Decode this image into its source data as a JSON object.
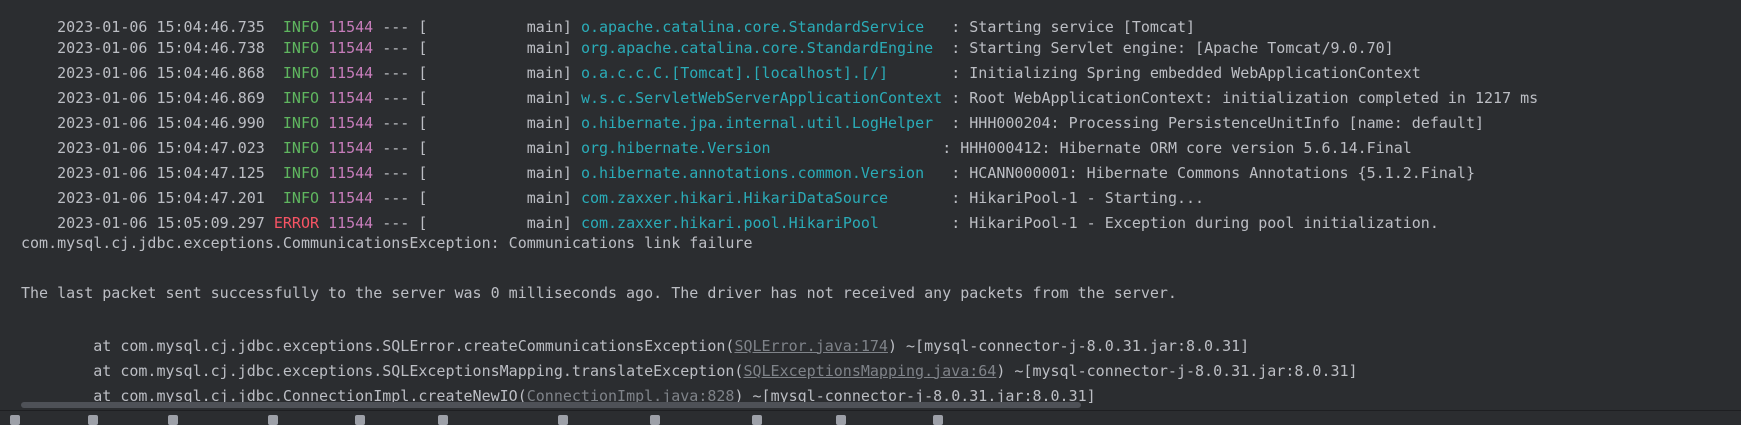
{
  "log_lines": [
    {
      "date": "2023-01-06 15:04:46.738",
      "level": "INFO",
      "pid": "11544",
      "sep": "---",
      "thread_open": "[",
      "thread": "main]",
      "logger": "org.apache.catalina.core.StandardEngine",
      "message": ": Starting Servlet engine: [Apache Tomcat/9.0.70]"
    },
    {
      "date": "2023-01-06 15:04:46.868",
      "level": "INFO",
      "pid": "11544",
      "sep": "---",
      "thread_open": "[",
      "thread": "main]",
      "logger": "o.a.c.c.C.[Tomcat].[localhost].[/]",
      "message": ": Initializing Spring embedded WebApplicationContext"
    },
    {
      "date": "2023-01-06 15:04:46.869",
      "level": "INFO",
      "pid": "11544",
      "sep": "---",
      "thread_open": "[",
      "thread": "main]",
      "logger": "w.s.c.ServletWebServerApplicationContext",
      "message": ": Root WebApplicationContext: initialization completed in 1217 ms"
    },
    {
      "date": "2023-01-06 15:04:46.990",
      "level": "INFO",
      "pid": "11544",
      "sep": "---",
      "thread_open": "[",
      "thread": "main]",
      "logger": "o.hibernate.jpa.internal.util.LogHelper",
      "message": ": HHH000204: Processing PersistenceUnitInfo [name: default]"
    },
    {
      "date": "2023-01-06 15:04:47.023",
      "level": "INFO",
      "pid": "11544",
      "sep": "---",
      "thread_open": "[",
      "thread": "main]",
      "logger": "org.hibernate.Version",
      "message": ": HHH000412: Hibernate ORM core version 5.6.14.Final"
    },
    {
      "date": "2023-01-06 15:04:47.125",
      "level": "INFO",
      "pid": "11544",
      "sep": "---",
      "thread_open": "[",
      "thread": "main]",
      "logger": "o.hibernate.annotations.common.Version",
      "message": ": HCANN000001: Hibernate Commons Annotations {5.1.2.Final}"
    },
    {
      "date": "2023-01-06 15:04:47.201",
      "level": "INFO",
      "pid": "11544",
      "sep": "---",
      "thread_open": "[",
      "thread": "main]",
      "logger": "com.zaxxer.hikari.HikariDataSource",
      "message": ": HikariPool-1 - Starting..."
    },
    {
      "date": "2023-01-06 15:05:09.297",
      "level": "ERROR",
      "pid": "11544",
      "sep": "---",
      "thread_open": "[",
      "thread": "main]",
      "logger": "com.zaxxer.hikari.pool.HikariPool",
      "message": ": HikariPool-1 - Exception during pool initialization."
    }
  ],
  "exception_line": "com.mysql.cj.jdbc.exceptions.CommunicationsException: Communications link failure",
  "detail_line": "The last packet sent successfully to the server was 0 milliseconds ago. The driver has not received any packets from the server.",
  "stack": [
    {
      "prefix": "    at com.mysql.cj.jdbc.exceptions.SQLError.createCommunicationsException(",
      "link": "SQLError.java:174",
      "suffix": ") ~[mysql-connector-j-8.0.31.jar:8.0.31]"
    },
    {
      "prefix": "    at com.mysql.cj.jdbc.exceptions.SQLExceptionsMapping.translateException(",
      "link": "SQLExceptionsMapping.java:64",
      "suffix": ") ~[mysql-connector-j-8.0.31.jar:8.0.31]"
    },
    {
      "prefix": "    at com.mysql.cj.jdbc.ConnectionImpl.createNewIO(",
      "link": "ConnectionImpl.java:828",
      "suffix": ") ~[mysql-connector-j-8.0.31.jar:8.0.31]"
    }
  ],
  "colors": {
    "background": "#2b2d30",
    "info": "#5fb65f",
    "error": "#f75464",
    "pid": "#c77dbb",
    "logger": "#2aacb8",
    "text": "#bcbec4"
  }
}
